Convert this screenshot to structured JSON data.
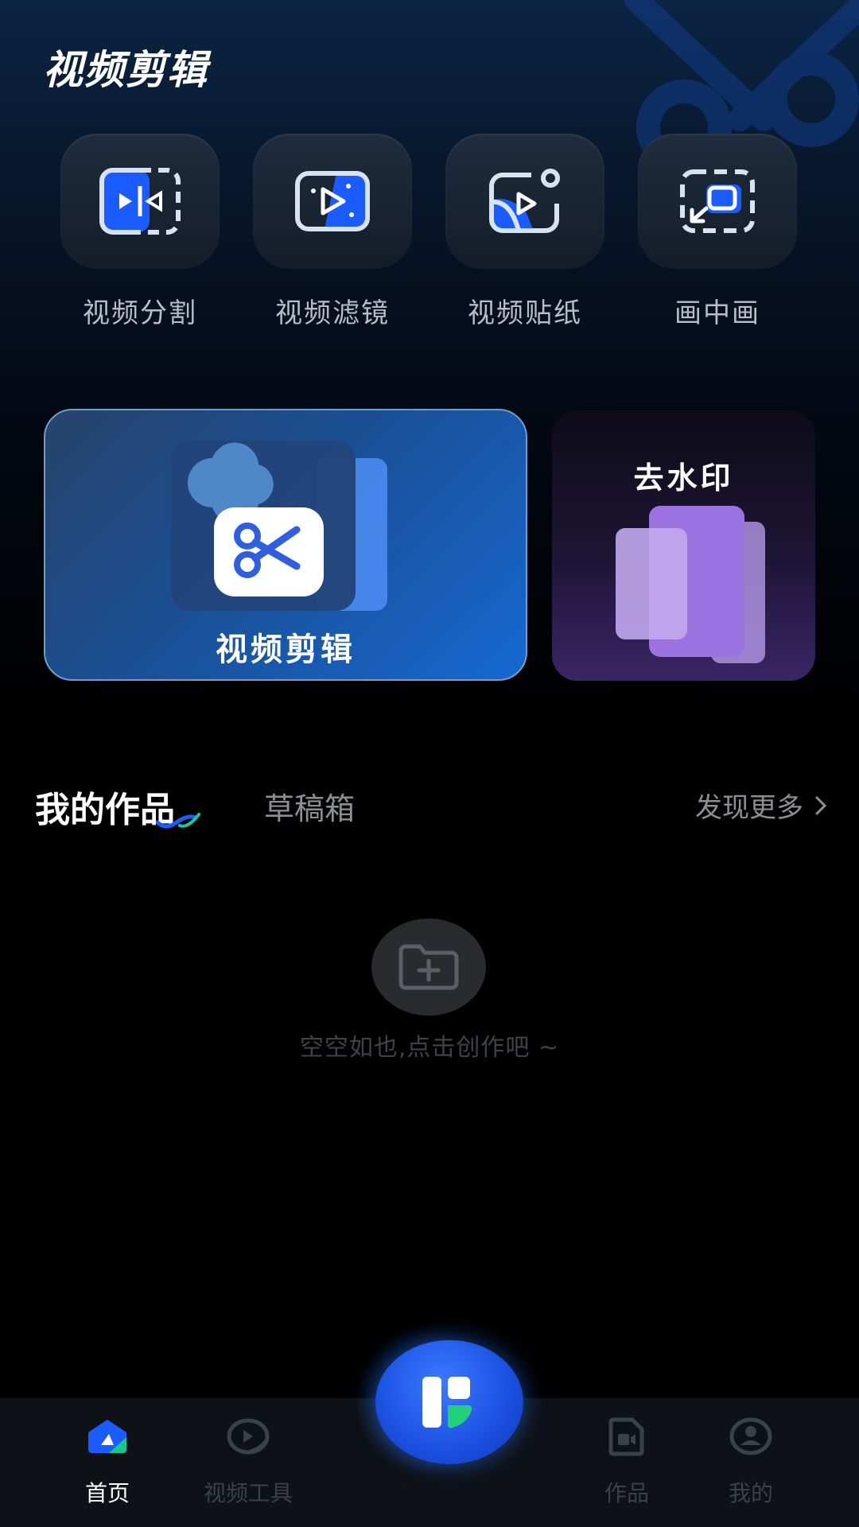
{
  "header": {
    "title": "视频剪辑"
  },
  "tools": [
    {
      "label": "视频分割",
      "icon": "split-icon"
    },
    {
      "label": "视频滤镜",
      "icon": "filter-icon"
    },
    {
      "label": "视频贴纸",
      "icon": "sticker-icon"
    },
    {
      "label": "画中画",
      "icon": "picture-in-picture-icon"
    }
  ],
  "cards": {
    "edit": {
      "label": "视频剪辑",
      "icon": "scissors-icon"
    },
    "watermark": {
      "label": "去水印",
      "icon": "stacked-layers-icon"
    }
  },
  "tabs": {
    "works": "我的作品",
    "drafts": "草稿箱",
    "active": "works",
    "discover": "发现更多"
  },
  "empty": {
    "text": "空空如也,点击创作吧 ~",
    "icon": "folder-add-icon"
  },
  "nav": {
    "items": [
      {
        "label": "首页",
        "icon": "home-icon",
        "active": true
      },
      {
        "label": "视频工具",
        "icon": "video-tools-icon",
        "active": false
      },
      {
        "label": "作品",
        "icon": "works-icon",
        "active": false
      },
      {
        "label": "我的",
        "icon": "profile-icon",
        "active": false
      }
    ],
    "center": {
      "icon": "create-icon"
    }
  },
  "colors": {
    "accent": "#1a5cff",
    "active_nav": "#ffffff",
    "inactive_nav": "#3c4047",
    "label_gray": "#b9bec6"
  }
}
